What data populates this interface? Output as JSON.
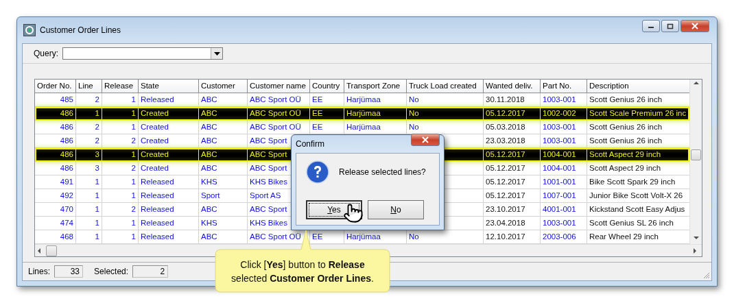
{
  "window": {
    "title": "Customer Order Lines"
  },
  "query": {
    "label": "Query:"
  },
  "table": {
    "columns": [
      {
        "label": "Order No.",
        "kind": "number"
      },
      {
        "label": "Line",
        "kind": "number"
      },
      {
        "label": "Release",
        "kind": "number"
      },
      {
        "label": "State",
        "kind": "text"
      },
      {
        "label": "Customer",
        "kind": "text"
      },
      {
        "label": "Customer name",
        "kind": "text"
      },
      {
        "label": "Country",
        "kind": "text"
      },
      {
        "label": "Transport Zone",
        "kind": "text"
      },
      {
        "label": "Truck Load created",
        "kind": "text"
      },
      {
        "label": "Wanted deliv.",
        "kind": "plain"
      },
      {
        "label": "Part No.",
        "kind": "text"
      },
      {
        "label": "Description",
        "kind": "plain"
      }
    ],
    "rows": [
      {
        "selected": false,
        "cells": [
          "485",
          "2",
          "1",
          "Released",
          "ABC",
          "ABC Sport OÜ",
          "EE",
          "Harjümaa",
          "No",
          "30.11.2018",
          "1003-001",
          "Scott Genius 26 inch"
        ]
      },
      {
        "selected": true,
        "cells": [
          "486",
          "1",
          "1",
          "Created",
          "ABC",
          "ABC Sport OÜ",
          "EE",
          "Harjümaa",
          "No",
          "05.12.2017",
          "1002-002",
          "Scott Scale Premium 26 inc"
        ]
      },
      {
        "selected": false,
        "cells": [
          "486",
          "2",
          "1",
          "Created",
          "ABC",
          "ABC Sport OÜ",
          "EE",
          "Harjümaa",
          "No",
          "05.03.2018",
          "1003-001",
          "Scott Genius 26 inch"
        ]
      },
      {
        "selected": false,
        "cells": [
          "486",
          "2",
          "2",
          "Created",
          "ABC",
          "ABC Sport",
          null,
          null,
          null,
          "23.03.2018",
          "1003-001",
          "Scott Genius 26 inch"
        ]
      },
      {
        "selected": true,
        "cells": [
          "486",
          "3",
          "1",
          "Created",
          "ABC",
          "ABC Sport",
          null,
          null,
          null,
          "05.12.2017",
          "1004-001",
          "Scott Aspect 29 inch"
        ]
      },
      {
        "selected": false,
        "cells": [
          "486",
          "3",
          "2",
          "Created",
          "ABC",
          "ABC Sport",
          null,
          null,
          null,
          "05.12.2017",
          "1004-001",
          "Scott Aspect 29 inch"
        ]
      },
      {
        "selected": false,
        "cells": [
          "491",
          "1",
          "1",
          "Released",
          "KHS",
          "KHS Bikes",
          null,
          null,
          null,
          "05.12.2017",
          "1001-001",
          "Bike Scott Spark 29 inch"
        ]
      },
      {
        "selected": false,
        "cells": [
          "492",
          "1",
          "1",
          "Released",
          "Sport",
          "Sport AS",
          null,
          null,
          null,
          "05.12.2017",
          "1007-001",
          "Junior Bike Scott Volt-X 26"
        ]
      },
      {
        "selected": false,
        "cells": [
          "470",
          "1",
          "2",
          "Released",
          "ABC",
          "ABC Sport",
          null,
          null,
          null,
          "23.10.2017",
          "4001-001",
          "Kickstand Scott Easy Adjus"
        ]
      },
      {
        "selected": false,
        "cells": [
          "474",
          "1",
          "1",
          "Released",
          "KHS",
          "KHS Bikes",
          null,
          null,
          null,
          "23.04.2018",
          "1003-001",
          "Scott Genius SL 26 inch"
        ]
      },
      {
        "selected": false,
        "cells": [
          "468",
          "1",
          "1",
          "Released",
          "ABC",
          "ABC Sport OÜ",
          "EE",
          "Harjümaa",
          "No",
          "12.10.2017",
          "2003-006",
          "Rear Wheel 29 inch"
        ]
      }
    ]
  },
  "dialog": {
    "title": "Confirm",
    "message": "Release selected lines?",
    "buttons": [
      {
        "label": "Yes",
        "focused": true
      },
      {
        "label": "No",
        "focused": false
      }
    ]
  },
  "status_bar": {
    "fields": [
      {
        "label": "Lines:",
        "value": "33"
      },
      {
        "label": "Selected:",
        "value": "2"
      }
    ]
  },
  "callout": {
    "text": "Click [**Yes**] button to **Release** selected **Customer Order Lines**."
  }
}
